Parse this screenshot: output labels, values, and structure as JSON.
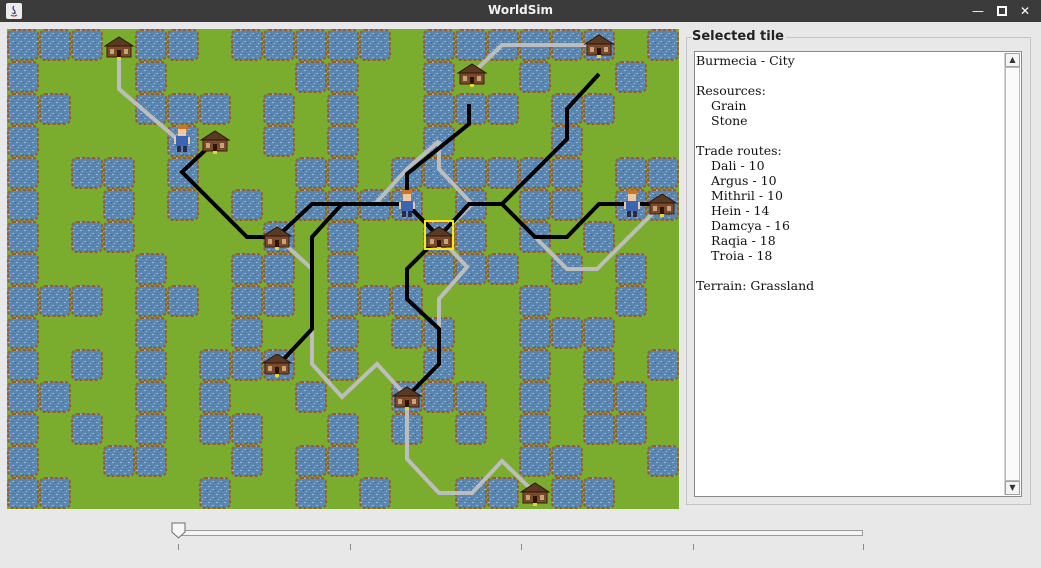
{
  "window": {
    "title": "WorldSim",
    "icons": [
      "java-app-icon",
      "minimize-icon",
      "maximize-icon",
      "close-icon"
    ]
  },
  "colors": {
    "grass": "#7aac2e",
    "water": "#5b86b0",
    "shore": "#9a5a2e",
    "route_active": "#000000",
    "route_inactive": "#bdbdbd",
    "selection": "#ffe21a"
  },
  "map": {
    "cities": [
      {
        "name": "city-1"
      },
      {
        "name": "city-2"
      },
      {
        "name": "city-3"
      },
      {
        "name": "city-4"
      },
      {
        "name": "city-5"
      },
      {
        "name": "city-6"
      },
      {
        "name": "city-7"
      },
      {
        "name": "city-8"
      },
      {
        "name": "city-9"
      },
      {
        "name": "city-10"
      },
      {
        "name": "city-11"
      }
    ],
    "selected_city": "Burmecia"
  },
  "panel": {
    "title": "Selected tile",
    "tile_name": "Burmecia - City",
    "resources_label": "Resources:",
    "resources": [
      "Grain",
      "Stone"
    ],
    "trade_routes_label": "Trade routes:",
    "trade_routes": [
      "Dali - 10",
      "Argus - 10",
      "Mithril - 10",
      "Hein - 14",
      "Damcya - 16",
      "Raqia - 18",
      "Troia - 18"
    ],
    "terrain": "Terrain: Grassland"
  },
  "slider": {
    "value": 0,
    "ticks": 5
  }
}
